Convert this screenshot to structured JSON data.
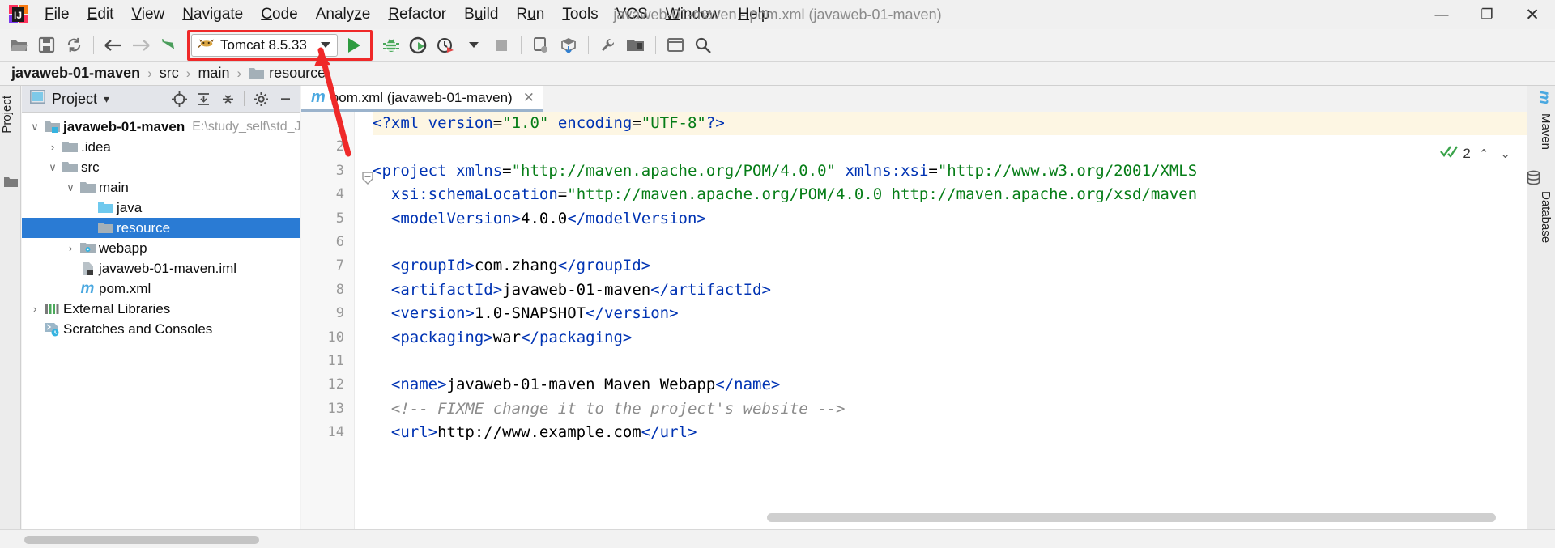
{
  "window": {
    "title": "javaweb-01-maven - pom.xml (javaweb-01-maven)",
    "minimize": "—",
    "maximize": "❐",
    "close": "✕"
  },
  "menubar": {
    "items": [
      {
        "label": "File",
        "mnemonic": "F"
      },
      {
        "label": "Edit",
        "mnemonic": "E"
      },
      {
        "label": "View",
        "mnemonic": "V"
      },
      {
        "label": "Navigate",
        "mnemonic": "N"
      },
      {
        "label": "Code",
        "mnemonic": "C"
      },
      {
        "label": "Analyze",
        "mnemonic": "z"
      },
      {
        "label": "Refactor",
        "mnemonic": "R"
      },
      {
        "label": "Build",
        "mnemonic": "u"
      },
      {
        "label": "Run",
        "mnemonic": "u"
      },
      {
        "label": "Tools",
        "mnemonic": "T"
      },
      {
        "label": "VCS",
        "mnemonic": ""
      },
      {
        "label": "Window",
        "mnemonic": "W"
      },
      {
        "label": "Help",
        "mnemonic": "H"
      }
    ]
  },
  "toolbar": {
    "icons": [
      {
        "name": "open-project-icon"
      },
      {
        "name": "save-all-icon"
      },
      {
        "name": "sync-refresh-icon"
      },
      {
        "name": "navigate-back-icon"
      },
      {
        "name": "navigate-forward-icon"
      },
      {
        "name": "show-history-icon"
      }
    ],
    "run_config": {
      "label": "Tomcat 8.5.33",
      "icon": "tomcat-cat-icon",
      "highlight_color": "#ef2929"
    },
    "run_button": "run-icon",
    "debug_button": "debug-bug-icon",
    "run_coverage_button": "run-with-coverage-icon",
    "profile_button": "profiler-icon",
    "stop_button": "stop-icon",
    "right_icons": [
      {
        "name": "update-app-icon"
      },
      {
        "name": "build-artifact-icon"
      },
      {
        "name": "settings-wrench-icon"
      },
      {
        "name": "project-structure-icon"
      },
      {
        "name": "terminal-icon"
      },
      {
        "name": "search-everywhere-icon"
      }
    ]
  },
  "breadcrumb": {
    "items": [
      "javaweb-01-maven",
      "src",
      "main",
      "resource"
    ],
    "separator": "›"
  },
  "left_strip": {
    "tabs": [
      "Project"
    ],
    "structure_icon": "structure-folder-icon"
  },
  "project_panel": {
    "title": "Project",
    "view_icon": "project-view-icon",
    "dropdown": "▾",
    "actions": [
      {
        "name": "select-opened-file-icon"
      },
      {
        "name": "expand-all-icon"
      },
      {
        "name": "collapse-all-icon"
      },
      {
        "name": "settings-gear-icon"
      },
      {
        "name": "hide-panel-icon"
      }
    ],
    "tree": [
      {
        "label": "javaweb-01-maven",
        "path": "E:\\study_self\\std_JAV",
        "depth": 0,
        "twist": "expanded",
        "icon": "module-folder-icon",
        "bold": true,
        "selected": false
      },
      {
        "label": ".idea",
        "path": "",
        "depth": 1,
        "twist": "collapsed",
        "icon": "folder-icon",
        "bold": false,
        "selected": false
      },
      {
        "label": "src",
        "path": "",
        "depth": 1,
        "twist": "expanded",
        "icon": "folder-icon",
        "bold": false,
        "selected": false
      },
      {
        "label": "main",
        "path": "",
        "depth": 2,
        "twist": "expanded",
        "icon": "folder-icon",
        "bold": false,
        "selected": false
      },
      {
        "label": "java",
        "path": "",
        "depth": 3,
        "twist": "none",
        "icon": "source-folder-icon",
        "bold": false,
        "selected": false
      },
      {
        "label": "resource",
        "path": "",
        "depth": 3,
        "twist": "none",
        "icon": "folder-icon",
        "bold": false,
        "selected": true
      },
      {
        "label": "webapp",
        "path": "",
        "depth": 2,
        "twist": "collapsed",
        "icon": "web-folder-icon",
        "bold": false,
        "selected": false
      },
      {
        "label": "javaweb-01-maven.iml",
        "path": "",
        "depth": 2,
        "twist": "none",
        "icon": "iml-file-icon",
        "bold": false,
        "selected": false
      },
      {
        "label": "pom.xml",
        "path": "",
        "depth": 2,
        "twist": "none",
        "icon": "maven-m-icon",
        "bold": false,
        "selected": false
      },
      {
        "label": "External Libraries",
        "path": "",
        "depth": 0,
        "twist": "collapsed",
        "icon": "libraries-icon",
        "bold": false,
        "selected": false
      },
      {
        "label": "Scratches and Consoles",
        "path": "",
        "depth": 0,
        "twist": "none",
        "icon": "scratches-icon",
        "bold": false,
        "selected": false
      }
    ]
  },
  "editor": {
    "tab": {
      "label": "pom.xml (javaweb-01-maven)",
      "icon": "maven-m-icon",
      "close": "✕"
    },
    "inspections": {
      "count": "2",
      "icon": "inspection-check-icon",
      "up": "⌃",
      "down": "⌄"
    },
    "line_numbers": [
      "1",
      "2",
      "3",
      "4",
      "5",
      "6",
      "7",
      "8",
      "9",
      "10",
      "11",
      "12",
      "13",
      "14"
    ],
    "lines": [
      {
        "n": 1,
        "highlight": true,
        "tokens": [
          {
            "t": "<?xml ",
            "c": "pi"
          },
          {
            "t": "version",
            "c": "attr"
          },
          {
            "t": "=",
            "c": "punct"
          },
          {
            "t": "\"1.0\"",
            "c": "str"
          },
          {
            "t": " ",
            "c": "txt"
          },
          {
            "t": "encoding",
            "c": "attr"
          },
          {
            "t": "=",
            "c": "punct"
          },
          {
            "t": "\"UTF-8\"",
            "c": "str"
          },
          {
            "t": "?>",
            "c": "pi"
          }
        ]
      },
      {
        "n": 2,
        "highlight": false,
        "tokens": []
      },
      {
        "n": 3,
        "highlight": false,
        "tokens": [
          {
            "t": "<project ",
            "c": "tag"
          },
          {
            "t": "xmlns",
            "c": "attr"
          },
          {
            "t": "=",
            "c": "punct"
          },
          {
            "t": "\"http://maven.apache.org/POM/4.0.0\"",
            "c": "str"
          },
          {
            "t": " ",
            "c": "txt"
          },
          {
            "t": "xmlns:xsi",
            "c": "attr"
          },
          {
            "t": "=",
            "c": "punct"
          },
          {
            "t": "\"http://www.w3.org/2001/XMLS",
            "c": "str"
          }
        ]
      },
      {
        "n": 4,
        "highlight": false,
        "tokens": [
          {
            "t": "  ",
            "c": "txt"
          },
          {
            "t": "xsi:schemaLocation",
            "c": "attr"
          },
          {
            "t": "=",
            "c": "punct"
          },
          {
            "t": "\"http://maven.apache.org/POM/4.0.0 http://maven.apache.org/xsd/maven",
            "c": "str"
          }
        ]
      },
      {
        "n": 5,
        "highlight": false,
        "tokens": [
          {
            "t": "  ",
            "c": "txt"
          },
          {
            "t": "<modelVersion>",
            "c": "tag"
          },
          {
            "t": "4.0.0",
            "c": "txt"
          },
          {
            "t": "</modelVersion>",
            "c": "tag"
          }
        ]
      },
      {
        "n": 6,
        "highlight": false,
        "tokens": []
      },
      {
        "n": 7,
        "highlight": false,
        "tokens": [
          {
            "t": "  ",
            "c": "txt"
          },
          {
            "t": "<groupId>",
            "c": "tag"
          },
          {
            "t": "com.zhang",
            "c": "txt"
          },
          {
            "t": "</groupId>",
            "c": "tag"
          }
        ]
      },
      {
        "n": 8,
        "highlight": false,
        "tokens": [
          {
            "t": "  ",
            "c": "txt"
          },
          {
            "t": "<artifactId>",
            "c": "tag"
          },
          {
            "t": "javaweb-01-maven",
            "c": "txt"
          },
          {
            "t": "</artifactId>",
            "c": "tag"
          }
        ]
      },
      {
        "n": 9,
        "highlight": false,
        "tokens": [
          {
            "t": "  ",
            "c": "txt"
          },
          {
            "t": "<version>",
            "c": "tag"
          },
          {
            "t": "1.0-SNAPSHOT",
            "c": "txt"
          },
          {
            "t": "</version>",
            "c": "tag"
          }
        ]
      },
      {
        "n": 10,
        "highlight": false,
        "tokens": [
          {
            "t": "  ",
            "c": "txt"
          },
          {
            "t": "<packaging>",
            "c": "tag"
          },
          {
            "t": "war",
            "c": "txt"
          },
          {
            "t": "</packaging>",
            "c": "tag"
          }
        ]
      },
      {
        "n": 11,
        "highlight": false,
        "tokens": []
      },
      {
        "n": 12,
        "highlight": false,
        "tokens": [
          {
            "t": "  ",
            "c": "txt"
          },
          {
            "t": "<name>",
            "c": "tag"
          },
          {
            "t": "javaweb-01-maven Maven Webapp",
            "c": "txt"
          },
          {
            "t": "</name>",
            "c": "tag"
          }
        ]
      },
      {
        "n": 13,
        "highlight": false,
        "tokens": [
          {
            "t": "  ",
            "c": "txt"
          },
          {
            "t": "<!-- FIXME change it to the project's website -->",
            "c": "com"
          }
        ]
      },
      {
        "n": 14,
        "highlight": false,
        "tokens": [
          {
            "t": "  ",
            "c": "txt"
          },
          {
            "t": "<url>",
            "c": "tag"
          },
          {
            "t": "http://www.example.com",
            "c": "txt"
          },
          {
            "t": "</url>",
            "c": "tag"
          }
        ]
      }
    ]
  },
  "right_strip": {
    "tabs": [
      "m",
      "Maven",
      "Database"
    ]
  }
}
